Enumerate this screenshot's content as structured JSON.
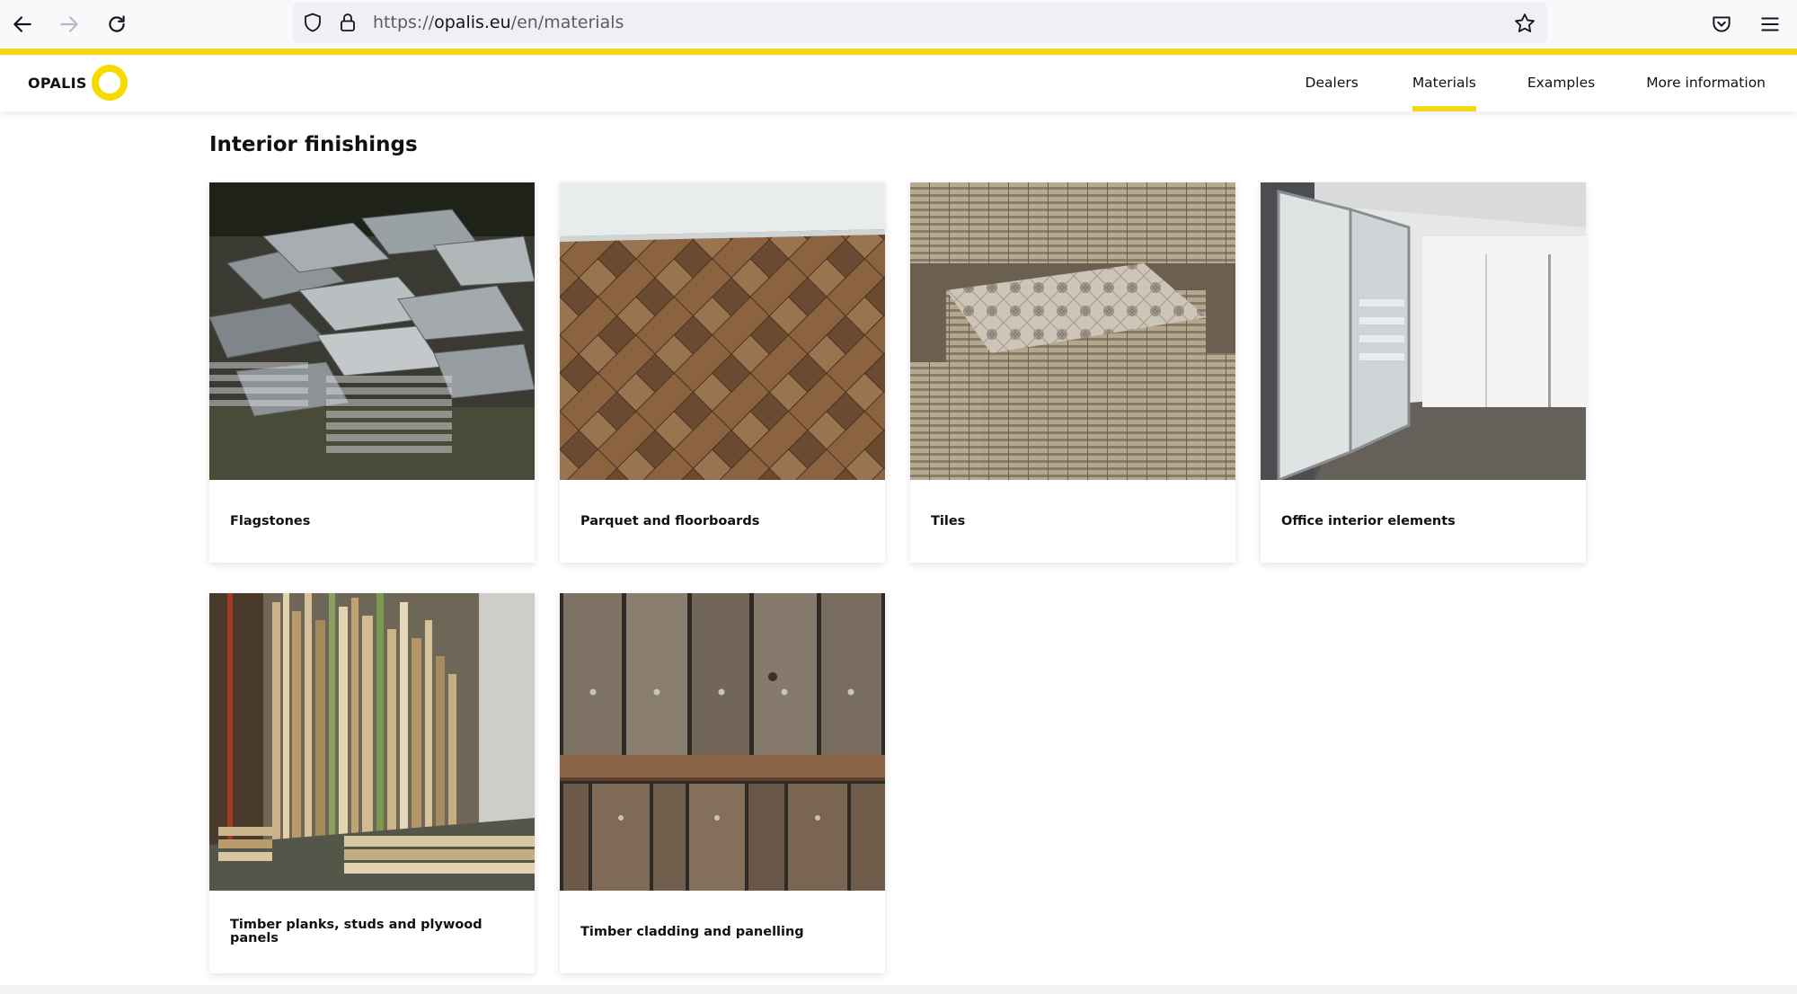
{
  "browser": {
    "url_scheme": "https://",
    "url_host": "opalis.eu",
    "url_path": "/en/materials",
    "icons": [
      "back-arrow-icon",
      "forward-arrow-icon",
      "reload-icon",
      "shield-icon",
      "lock-icon",
      "star-icon",
      "pocket-icon",
      "menu-icon"
    ]
  },
  "site": {
    "logo_text": "OPALIS",
    "accent_color": "#f3d81a",
    "nav": [
      {
        "label": "Dealers",
        "active": false
      },
      {
        "label": "Materials",
        "active": true
      },
      {
        "label": "Examples",
        "active": false
      },
      {
        "label": "More information",
        "active": false
      }
    ]
  },
  "main": {
    "title": "Interior finishings",
    "cards": [
      {
        "label": "Flagstones",
        "image": "stacked-flagstones"
      },
      {
        "label": "Parquet and floorboards",
        "image": "herringbone-parquet"
      },
      {
        "label": "Tiles",
        "image": "stacked-tiles"
      },
      {
        "label": "Office interior elements",
        "image": "office-glass-partitions"
      },
      {
        "label": "Timber planks, studs and plywood panels",
        "image": "timber-planks-rack"
      },
      {
        "label": "Timber cladding and panelling",
        "image": "weathered-wood-cladding"
      }
    ]
  }
}
